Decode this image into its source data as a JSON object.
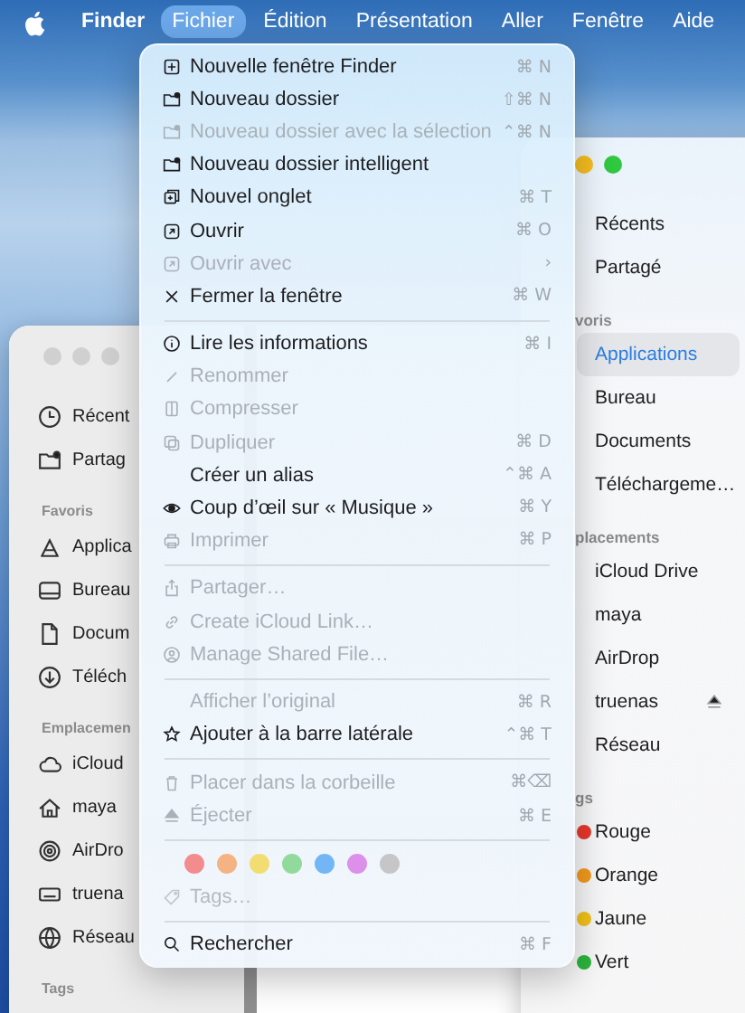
{
  "menu_bar": {
    "items": [
      {
        "label": "Finder",
        "selected": false
      },
      {
        "label": "Fichier",
        "selected": true
      },
      {
        "label": "Édition",
        "selected": false
      },
      {
        "label": "Présentation",
        "selected": false
      },
      {
        "label": "Aller",
        "selected": false
      },
      {
        "label": "Fenêtre",
        "selected": false
      },
      {
        "label": "Aide",
        "selected": false
      }
    ]
  },
  "left_window": {
    "sections": [
      {
        "items": [
          {
            "label": "Récent"
          },
          {
            "label": "Partag"
          }
        ]
      },
      {
        "header": "Favoris",
        "items": [
          {
            "label": "Applica"
          },
          {
            "label": "Bureau"
          },
          {
            "label": "Docum"
          },
          {
            "label": "Téléch"
          }
        ]
      },
      {
        "header": "Emplacemen",
        "items": [
          {
            "label": "iCloud"
          },
          {
            "label": "maya"
          },
          {
            "label": "AirDro"
          },
          {
            "label": "truena"
          },
          {
            "label": "Réseau"
          }
        ]
      },
      {
        "header": "Tags"
      }
    ]
  },
  "right_window": {
    "sections": [
      {
        "items": [
          {
            "label": "Récents",
            "selected": false
          },
          {
            "label": "Partagé",
            "selected": false
          }
        ]
      },
      {
        "header": "voris",
        "items": [
          {
            "label": "Applications",
            "selected": true
          },
          {
            "label": "Bureau",
            "selected": false
          },
          {
            "label": "Documents",
            "selected": false
          },
          {
            "label": "Téléchargeme…",
            "selected": false
          }
        ]
      },
      {
        "header": "placements",
        "items": [
          {
            "label": "iCloud Drive",
            "selected": false,
            "ejectable": false
          },
          {
            "label": "maya",
            "selected": false,
            "ejectable": false
          },
          {
            "label": "AirDrop",
            "selected": false,
            "ejectable": false
          },
          {
            "label": "truenas",
            "selected": false,
            "ejectable": true
          },
          {
            "label": "Réseau",
            "selected": false,
            "ejectable": false
          }
        ]
      },
      {
        "header": "gs",
        "items": [
          {
            "label": "Rouge",
            "selected": false,
            "color": "#e8372c"
          },
          {
            "label": "Orange",
            "selected": false,
            "color": "#f29a1d"
          },
          {
            "label": "Jaune",
            "selected": false,
            "color": "#f2c31a"
          },
          {
            "label": "Vert",
            "selected": false,
            "color": "#2bb43d"
          }
        ]
      }
    ]
  },
  "file_menu": {
    "entries": [
      {
        "kind": "item",
        "label": "Nouvelle fenêtre Finder",
        "shortcut": "⌘ N",
        "disabled": false
      },
      {
        "kind": "item",
        "label": "Nouveau dossier",
        "shortcut": "⇧⌘ N",
        "disabled": false
      },
      {
        "kind": "item",
        "label": "Nouveau dossier avec la sélection",
        "shortcut": "⌃⌘ N",
        "disabled": true
      },
      {
        "kind": "item",
        "label": "Nouveau dossier intelligent",
        "disabled": false
      },
      {
        "kind": "item",
        "label": "Nouvel onglet",
        "shortcut": "⌘ T",
        "disabled": false
      },
      {
        "kind": "item",
        "label": "Ouvrir",
        "shortcut": "⌘ O",
        "disabled": false
      },
      {
        "kind": "item",
        "label": "Ouvrir avec",
        "shortcut": "›",
        "disabled": true
      },
      {
        "kind": "item",
        "label": "Fermer la fenêtre",
        "shortcut": "⌘ W",
        "disabled": false
      },
      {
        "kind": "separator"
      },
      {
        "kind": "item",
        "label": "Lire les informations",
        "shortcut": "⌘ I",
        "disabled": false
      },
      {
        "kind": "item",
        "label": "Renommer",
        "disabled": true
      },
      {
        "kind": "item",
        "label": "Compresser",
        "disabled": true
      },
      {
        "kind": "item",
        "label": "Dupliquer",
        "shortcut": "⌘ D",
        "disabled": true
      },
      {
        "kind": "item",
        "label": "Créer un alias",
        "shortcut": "⌃⌘ A",
        "disabled": false
      },
      {
        "kind": "item",
        "label": "Coup d’œil sur « Musique »",
        "shortcut": "⌘ Y",
        "disabled": false
      },
      {
        "kind": "item",
        "label": "Imprimer",
        "shortcut": "⌘ P",
        "disabled": true
      },
      {
        "kind": "separator"
      },
      {
        "kind": "item",
        "label": "Partager…",
        "disabled": true
      },
      {
        "kind": "item",
        "label": "Create iCloud Link…",
        "disabled": true
      },
      {
        "kind": "item",
        "label": "Manage Shared File…",
        "disabled": true
      },
      {
        "kind": "separator"
      },
      {
        "kind": "item",
        "label": "Afficher l’original",
        "shortcut": "⌘ R",
        "disabled": true
      },
      {
        "kind": "item",
        "label": "Ajouter à la barre latérale",
        "shortcut": "⌃⌘ T",
        "disabled": false
      },
      {
        "kind": "separator"
      },
      {
        "kind": "item",
        "label": "Placer dans la corbeille",
        "shortcut": "⌘⌫",
        "disabled": true
      },
      {
        "kind": "item",
        "label": "Éjecter",
        "shortcut": "⌘ E",
        "disabled": true
      },
      {
        "kind": "separator"
      },
      {
        "kind": "colors",
        "colors": [
          {
            "color": "#f28c8e"
          },
          {
            "color": "#f5b383"
          },
          {
            "color": "#f3dd72"
          },
          {
            "color": "#92da9b"
          },
          {
            "color": "#72b6f6"
          },
          {
            "color": "#dc90e9"
          },
          {
            "color": "#c6c6c8"
          }
        ]
      },
      {
        "kind": "field",
        "placeholder": "Tags…"
      },
      {
        "kind": "separator"
      },
      {
        "kind": "item",
        "label": "Rechercher",
        "shortcut": "⌘ F",
        "disabled": false
      }
    ]
  }
}
